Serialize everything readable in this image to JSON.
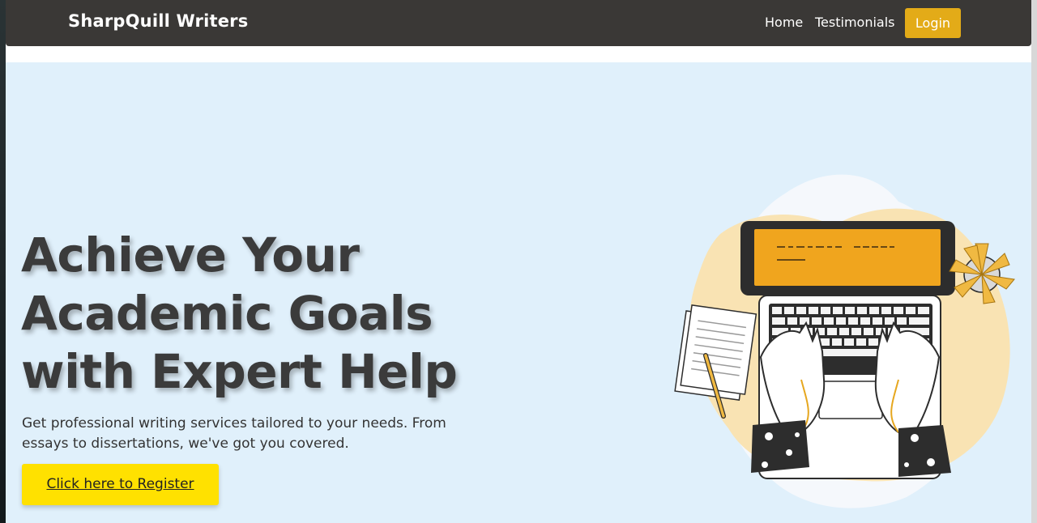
{
  "navbar": {
    "brand": "SharpQuill Writers",
    "links": [
      {
        "label": "Home"
      },
      {
        "label": "Testimonials"
      }
    ],
    "login_label": "Login"
  },
  "hero": {
    "headline_line1": "Achieve Your",
    "headline_line2": "Academic Goals",
    "headline_line3": "with Expert Help",
    "subtext": "Get professional writing services tailored to your needs. From essays to dissertations, we've got you covered.",
    "cta_label": "Click here to Register"
  },
  "colors": {
    "navbar_bg": "#3a3836",
    "login_bg": "#e3ab18",
    "hero_bg": "#e0f0fb",
    "cta_bg": "#ffe100",
    "accent_orange": "#f0a51e"
  },
  "icons": {
    "illustration": "person-typing-on-laptop-illustration"
  }
}
